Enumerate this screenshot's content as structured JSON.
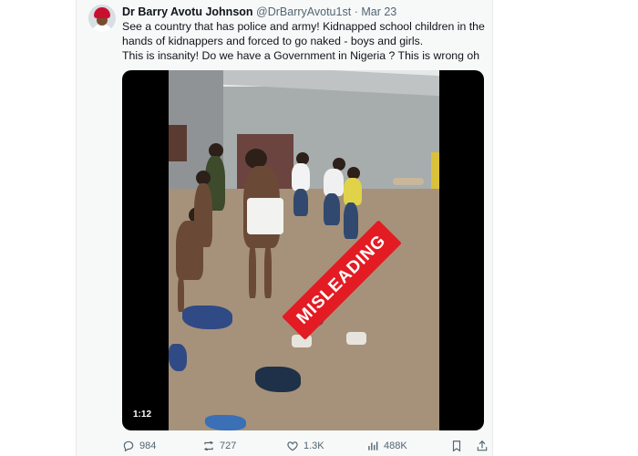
{
  "tweet": {
    "author_name": "Dr Barry Avotu Johnson",
    "handle": "@DrBarryAvotu1st",
    "separator": "·",
    "date": "Mar 23",
    "text_lines": [
      "See a country that has police and army! Kidnapped school children in the",
      "hands of kidnappers and forced to go naked - boys and girls.",
      "This is insanity!   Do we have a Government in Nigeria ? This is wrong oh"
    ]
  },
  "video": {
    "stamp_label": "MISLEADING",
    "duration": "1:12"
  },
  "actions": {
    "replies": "984",
    "reposts": "727",
    "likes": "1.3K",
    "views": "488K"
  },
  "colors": {
    "stamp": "#e31b23",
    "muted_text": "#536471",
    "text": "#0f1419"
  }
}
